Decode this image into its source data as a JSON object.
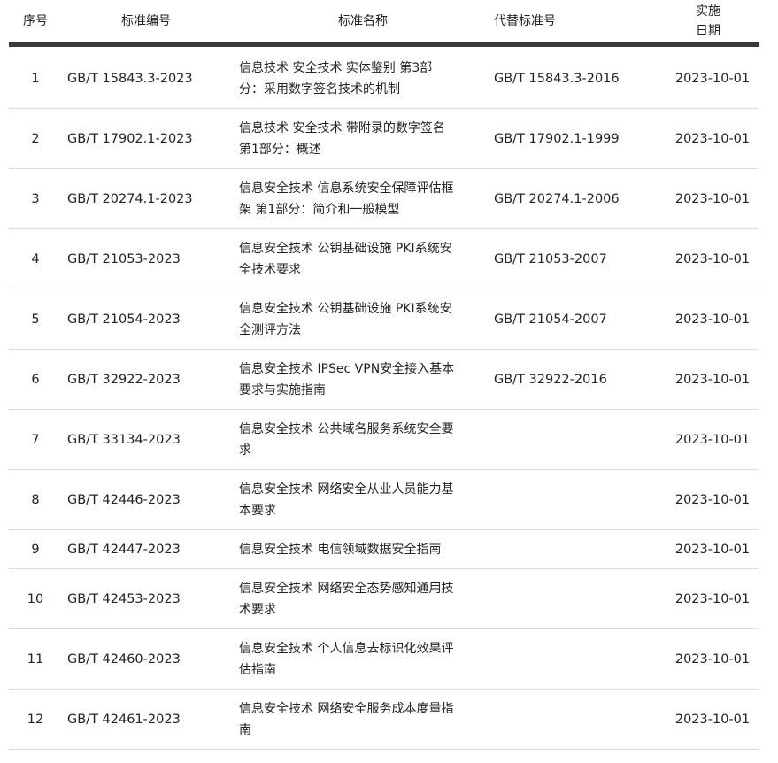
{
  "headers": {
    "seq": "序号",
    "code": "标准编号",
    "name": "标准名称",
    "replaces": "代替标准号",
    "date_line1": "实施",
    "date_line2": "日期"
  },
  "rows": [
    {
      "seq": "1",
      "code": "GB/T 15843.3-2023",
      "name_line1": "信息技术  安全技术  实体鉴别  第3部",
      "name_line2": "分：采用数字签名技术的机制",
      "replaces": "GB/T 15843.3-2016",
      "date": "2023-10-01"
    },
    {
      "seq": "2",
      "code": "GB/T 17902.1-2023",
      "name_line1": "信息技术  安全技术  带附录的数字签名",
      "name_line2": "第1部分：概述",
      "replaces": "GB/T 17902.1-1999",
      "date": "2023-10-01"
    },
    {
      "seq": "3",
      "code": "GB/T 20274.1-2023",
      "name_line1": "信息安全技术  信息系统安全保障评估框",
      "name_line2": "架  第1部分：简介和一般模型",
      "replaces": "GB/T 20274.1-2006",
      "date": "2023-10-01"
    },
    {
      "seq": "4",
      "code": "GB/T 21053-2023",
      "name_line1": "信息安全技术  公钥基础设施  PKI系统安",
      "name_line2": "全技术要求",
      "replaces": "GB/T 21053-2007",
      "date": "2023-10-01"
    },
    {
      "seq": "5",
      "code": "GB/T 21054-2023",
      "name_line1": "信息安全技术  公钥基础设施  PKI系统安",
      "name_line2": "全测评方法",
      "replaces": "GB/T 21054-2007",
      "date": "2023-10-01"
    },
    {
      "seq": "6",
      "code": "GB/T 32922-2023",
      "name_line1": "信息安全技术  IPSec  VPN安全接入基本",
      "name_line2": "要求与实施指南",
      "replaces": "GB/T 32922-2016",
      "date": "2023-10-01"
    },
    {
      "seq": "7",
      "code": "GB/T 33134-2023",
      "name_line1": "信息安全技术  公共域名服务系统安全要",
      "name_line2": "求",
      "replaces": "",
      "date": "2023-10-01"
    },
    {
      "seq": "8",
      "code": "GB/T 42446-2023",
      "name_line1": "信息安全技术  网络安全从业人员能力基",
      "name_line2": "本要求",
      "replaces": "",
      "date": "2023-10-01"
    },
    {
      "seq": "9",
      "code": "GB/T 42447-2023",
      "name_line1": "信息安全技术  电信领域数据安全指南",
      "name_line2": "",
      "replaces": "",
      "date": "2023-10-01"
    },
    {
      "seq": "10",
      "code": "GB/T 42453-2023",
      "name_line1": "信息安全技术  网络安全态势感知通用技",
      "name_line2": "术要求",
      "replaces": "",
      "date": "2023-10-01"
    },
    {
      "seq": "11",
      "code": "GB/T 42460-2023",
      "name_line1": "信息安全技术  个人信息去标识化效果评",
      "name_line2": "估指南",
      "replaces": "",
      "date": "2023-10-01"
    },
    {
      "seq": "12",
      "code": "GB/T 42461-2023",
      "name_line1": "信息安全技术  网络安全服务成本度量指",
      "name_line2": "南",
      "replaces": "",
      "date": "2023-10-01"
    }
  ]
}
